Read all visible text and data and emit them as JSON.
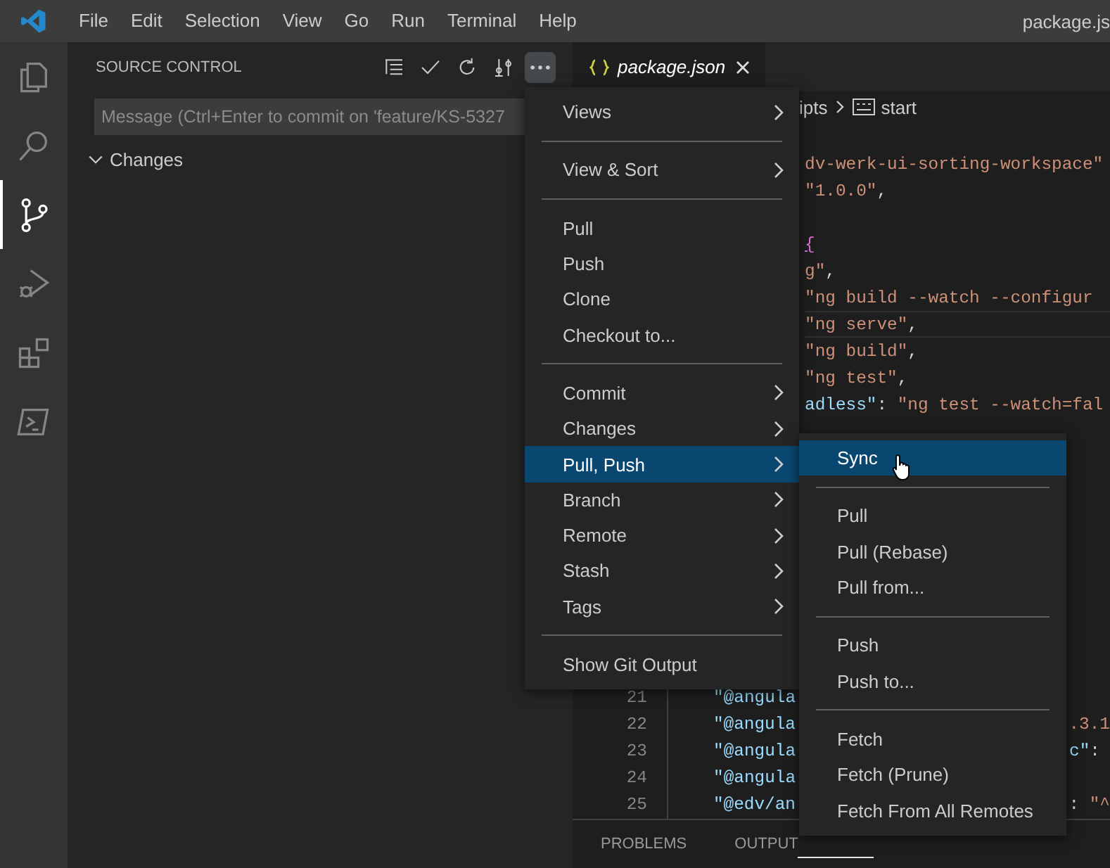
{
  "title_bar": {
    "menu": [
      "File",
      "Edit",
      "Selection",
      "View",
      "Go",
      "Run",
      "Terminal",
      "Help"
    ],
    "title": "package.js"
  },
  "activity_bar": {
    "items": [
      {
        "kind": "files",
        "selected": false
      },
      {
        "kind": "search",
        "selected": false
      },
      {
        "kind": "source-control",
        "selected": true
      },
      {
        "kind": "run-debug",
        "selected": false
      },
      {
        "kind": "extensions",
        "selected": false
      },
      {
        "kind": "terminal",
        "selected": false
      }
    ]
  },
  "sidebar": {
    "title": "SOURCE CONTROL",
    "actions": [
      {
        "kind": "tree",
        "active": false
      },
      {
        "kind": "check",
        "active": false
      },
      {
        "kind": "refresh",
        "active": false
      },
      {
        "kind": "compare",
        "active": false
      },
      {
        "kind": "more",
        "active": true
      }
    ],
    "message_field": {
      "placeholder": "Message (Ctrl+Enter to commit on 'feature/KS-5327"
    },
    "changes_group": {
      "label": "Changes",
      "expanded": true
    }
  },
  "editor": {
    "tabs": [
      {
        "label": "package.json",
        "selected": true
      }
    ],
    "breadcrumb": [
      {
        "kind": "folder",
        "text": "ipts"
      },
      {
        "kind": "string-symbol",
        "text": "start"
      }
    ],
    "lines": [
      {
        "kind": "code",
        "current": false,
        "segments": [
          {
            "kind": "string",
            "text": "dv-werk-ui-sorting-workspace\""
          }
        ]
      },
      {
        "kind": "code",
        "current": false,
        "segments": [
          {
            "kind": "string",
            "text": "\"1.0.0\""
          },
          {
            "kind": "punct",
            "text": ","
          }
        ]
      },
      {
        "kind": "blank"
      },
      {
        "kind": "code",
        "current": false,
        "segments": [
          {
            "kind": "brace",
            "text": "{"
          }
        ]
      },
      {
        "kind": "code",
        "current": false,
        "segments": [
          {
            "kind": "string",
            "text": "g\""
          },
          {
            "kind": "punct",
            "text": ","
          }
        ]
      },
      {
        "kind": "code",
        "current": false,
        "segments": [
          {
            "kind": "string",
            "text": "\"ng build --watch --configur"
          }
        ]
      },
      {
        "kind": "code",
        "current": true,
        "segments": [
          {
            "kind": "string",
            "text": "\"ng serve\""
          },
          {
            "kind": "punct",
            "text": ","
          }
        ]
      },
      {
        "kind": "code",
        "current": false,
        "segments": [
          {
            "kind": "string",
            "text": "\"ng build\""
          },
          {
            "kind": "punct",
            "text": ","
          }
        ]
      },
      {
        "kind": "code",
        "current": false,
        "segments": [
          {
            "kind": "string",
            "text": "\"ng test\""
          },
          {
            "kind": "punct",
            "text": ","
          }
        ]
      },
      {
        "kind": "code",
        "current": false,
        "segments": [
          {
            "kind": "key",
            "text": "adless\""
          },
          {
            "kind": "punct",
            "text": ": "
          },
          {
            "kind": "string",
            "text": "\"ng test --watch=fal"
          }
        ]
      }
    ],
    "numbered_lines": [
      {
        "number": "21",
        "segments": [
          {
            "kind": "key",
            "text": "\"@angula"
          }
        ]
      },
      {
        "number": "22",
        "segments": [
          {
            "kind": "key",
            "text": "\"@angula"
          }
        ],
        "tail": [
          {
            "kind": "string",
            "text": ".3.1"
          }
        ]
      },
      {
        "number": "23",
        "segments": [
          {
            "kind": "key",
            "text": "\"@angula"
          }
        ],
        "tail": [
          {
            "kind": "key",
            "text": "c\""
          },
          {
            "kind": "punct",
            "text": ":"
          }
        ]
      },
      {
        "number": "24",
        "segments": [
          {
            "kind": "key",
            "text": "\"@angula"
          }
        ]
      },
      {
        "number": "25",
        "segments": [
          {
            "kind": "key",
            "text": "\"@edv/an"
          }
        ],
        "tail": [
          {
            "kind": "punct",
            "text": ": "
          },
          {
            "kind": "string",
            "text": "\"^"
          }
        ]
      }
    ]
  },
  "panel": {
    "tabs": [
      {
        "label": "PROBLEMS",
        "selected": false
      },
      {
        "label": "OUTPUT",
        "selected": false
      }
    ]
  },
  "context_menu": {
    "items": [
      {
        "kind": "item",
        "label": "Views",
        "submenu": true,
        "selected": false
      },
      {
        "kind": "separator"
      },
      {
        "kind": "item",
        "label": "View & Sort",
        "submenu": true,
        "selected": false
      },
      {
        "kind": "separator"
      },
      {
        "kind": "item",
        "label": "Pull",
        "submenu": false,
        "selected": false
      },
      {
        "kind": "item",
        "label": "Push",
        "submenu": false,
        "selected": false
      },
      {
        "kind": "item",
        "label": "Clone",
        "submenu": false,
        "selected": false
      },
      {
        "kind": "item",
        "label": "Checkout to...",
        "submenu": false,
        "selected": false
      },
      {
        "kind": "separator"
      },
      {
        "kind": "item",
        "label": "Commit",
        "submenu": true,
        "selected": false
      },
      {
        "kind": "item",
        "label": "Changes",
        "submenu": true,
        "selected": false
      },
      {
        "kind": "item",
        "label": "Pull, Push",
        "submenu": true,
        "selected": true
      },
      {
        "kind": "item",
        "label": "Branch",
        "submenu": true,
        "selected": false
      },
      {
        "kind": "item",
        "label": "Remote",
        "submenu": true,
        "selected": false
      },
      {
        "kind": "item",
        "label": "Stash",
        "submenu": true,
        "selected": false
      },
      {
        "kind": "item",
        "label": "Tags",
        "submenu": true,
        "selected": false
      },
      {
        "kind": "separator"
      },
      {
        "kind": "item",
        "label": "Show Git Output",
        "submenu": false,
        "selected": false
      }
    ]
  },
  "submenu": {
    "items": [
      {
        "kind": "item",
        "label": "Sync",
        "submenu": false,
        "selected": true
      },
      {
        "kind": "separator"
      },
      {
        "kind": "item",
        "label": "Pull",
        "submenu": false,
        "selected": false
      },
      {
        "kind": "item",
        "label": "Pull (Rebase)",
        "submenu": false,
        "selected": false
      },
      {
        "kind": "item",
        "label": "Pull from...",
        "submenu": false,
        "selected": false
      },
      {
        "kind": "separator"
      },
      {
        "kind": "item",
        "label": "Push",
        "submenu": false,
        "selected": false
      },
      {
        "kind": "item",
        "label": "Push to...",
        "submenu": false,
        "selected": false
      },
      {
        "kind": "separator"
      },
      {
        "kind": "item",
        "label": "Fetch",
        "submenu": false,
        "selected": false
      },
      {
        "kind": "item",
        "label": "Fetch (Prune)",
        "submenu": false,
        "selected": false
      },
      {
        "kind": "item",
        "label": "Fetch From All Remotes",
        "submenu": false,
        "selected": false
      }
    ]
  }
}
